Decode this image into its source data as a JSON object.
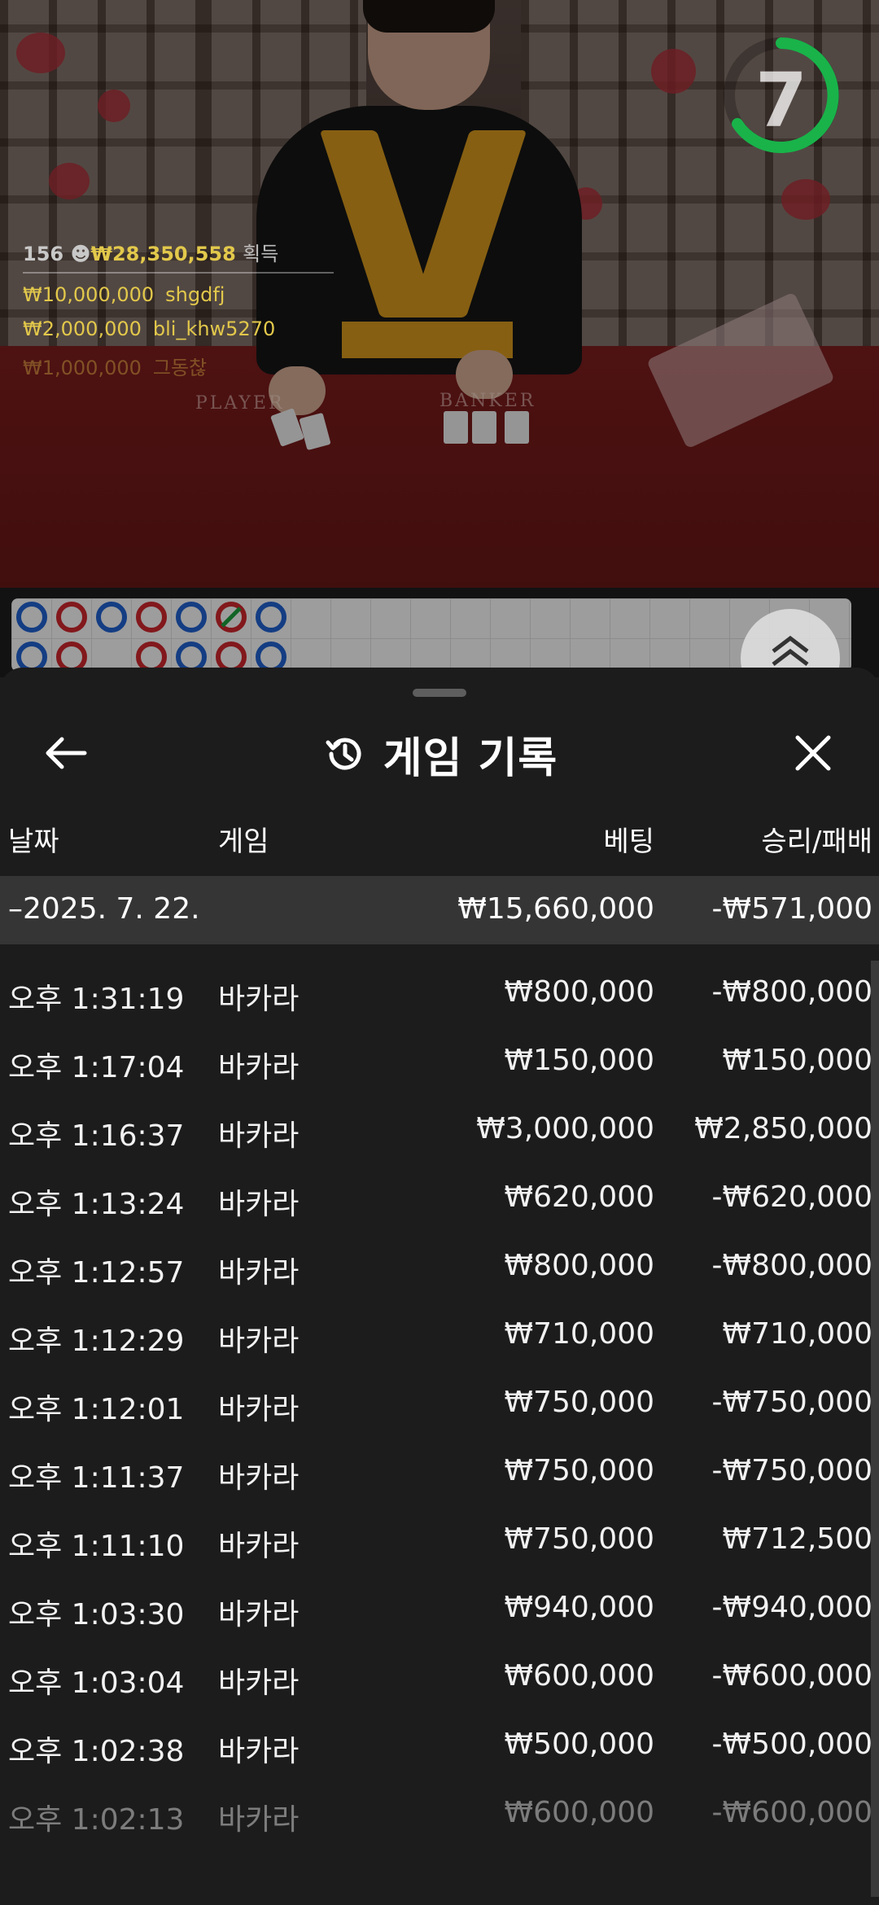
{
  "video": {
    "timer": "7",
    "felt_labels": [
      "PLAYER",
      "BANKER"
    ],
    "winners": {
      "count": "156",
      "total": "₩28,350,558",
      "suffix": "획득",
      "list": [
        {
          "amount": "₩10,000,000",
          "name": "shgdfj"
        },
        {
          "amount": "₩2,000,000",
          "name": "bli_khw5270"
        },
        {
          "amount": "₩1,000,000",
          "name": "그동찮"
        }
      ]
    }
  },
  "sheet": {
    "title": "게임 기록",
    "icons": [
      "back-arrow-icon",
      "history-icon",
      "close-icon",
      "chevron-up-icon"
    ],
    "columns": {
      "date": "날짜",
      "game": "게임",
      "bet": "베팅",
      "result": "승리/패배"
    },
    "summary": {
      "date": "–2025. 7. 22.",
      "bet": "₩15,660,000",
      "result": "-₩571,000"
    },
    "rows": [
      {
        "time": "오후 1:31:19",
        "game": "바카라",
        "bet": "₩800,000",
        "result": "-₩800,000"
      },
      {
        "time": "오후 1:17:04",
        "game": "바카라",
        "bet": "₩150,000",
        "result": "₩150,000"
      },
      {
        "time": "오후 1:16:37",
        "game": "바카라",
        "bet": "₩3,000,000",
        "result": "₩2,850,000"
      },
      {
        "time": "오후 1:13:24",
        "game": "바카라",
        "bet": "₩620,000",
        "result": "-₩620,000"
      },
      {
        "time": "오후 1:12:57",
        "game": "바카라",
        "bet": "₩800,000",
        "result": "-₩800,000"
      },
      {
        "time": "오후 1:12:29",
        "game": "바카라",
        "bet": "₩710,000",
        "result": "₩710,000"
      },
      {
        "time": "오후 1:12:01",
        "game": "바카라",
        "bet": "₩750,000",
        "result": "-₩750,000"
      },
      {
        "time": "오후 1:11:37",
        "game": "바카라",
        "bet": "₩750,000",
        "result": "-₩750,000"
      },
      {
        "time": "오후 1:11:10",
        "game": "바카라",
        "bet": "₩750,000",
        "result": "₩712,500"
      },
      {
        "time": "오후 1:03:30",
        "game": "바카라",
        "bet": "₩940,000",
        "result": "-₩940,000"
      },
      {
        "time": "오후 1:03:04",
        "game": "바카라",
        "bet": "₩600,000",
        "result": "-₩600,000"
      },
      {
        "time": "오후 1:02:38",
        "game": "바카라",
        "bet": "₩500,000",
        "result": "-₩500,000"
      },
      {
        "time": "오후 1:02:13",
        "game": "바카라",
        "bet": "₩600,000",
        "result": "-₩600,000"
      }
    ]
  },
  "colors": {
    "timer_ring": "#19b34a",
    "winner_gold": "#e2c84b",
    "banker_blue": "#1f5ec9",
    "player_red": "#c8262b",
    "tie_green": "#1a9a3a"
  }
}
